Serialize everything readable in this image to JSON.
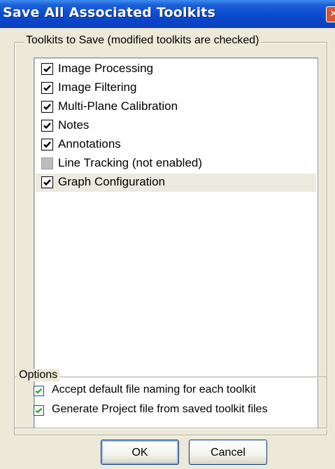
{
  "window": {
    "title": "Save All Associated Toolkits",
    "close_glyph": "✕"
  },
  "toolkits_group": {
    "legend": "Toolkits to Save (modified toolkits are checked)",
    "items": [
      {
        "label": "Image Processing",
        "state": "checked"
      },
      {
        "label": "Image Filtering",
        "state": "checked"
      },
      {
        "label": "Multi-Plane Calibration",
        "state": "checked"
      },
      {
        "label": "Notes",
        "state": "checked"
      },
      {
        "label": "Annotations",
        "state": "checked"
      },
      {
        "label": "Line Tracking (not enabled)",
        "state": "disabled"
      },
      {
        "label": "Graph Configuration",
        "state": "checked",
        "selected": true
      }
    ]
  },
  "options_group": {
    "legend": "Options",
    "accept_default_naming": {
      "label": "Accept default file naming for each toolkit",
      "checked": true
    },
    "generate_project_file": {
      "label": "Generate Project file from saved toolkit files",
      "checked": true
    }
  },
  "buttons": {
    "ok": "OK",
    "cancel": "Cancel"
  }
}
